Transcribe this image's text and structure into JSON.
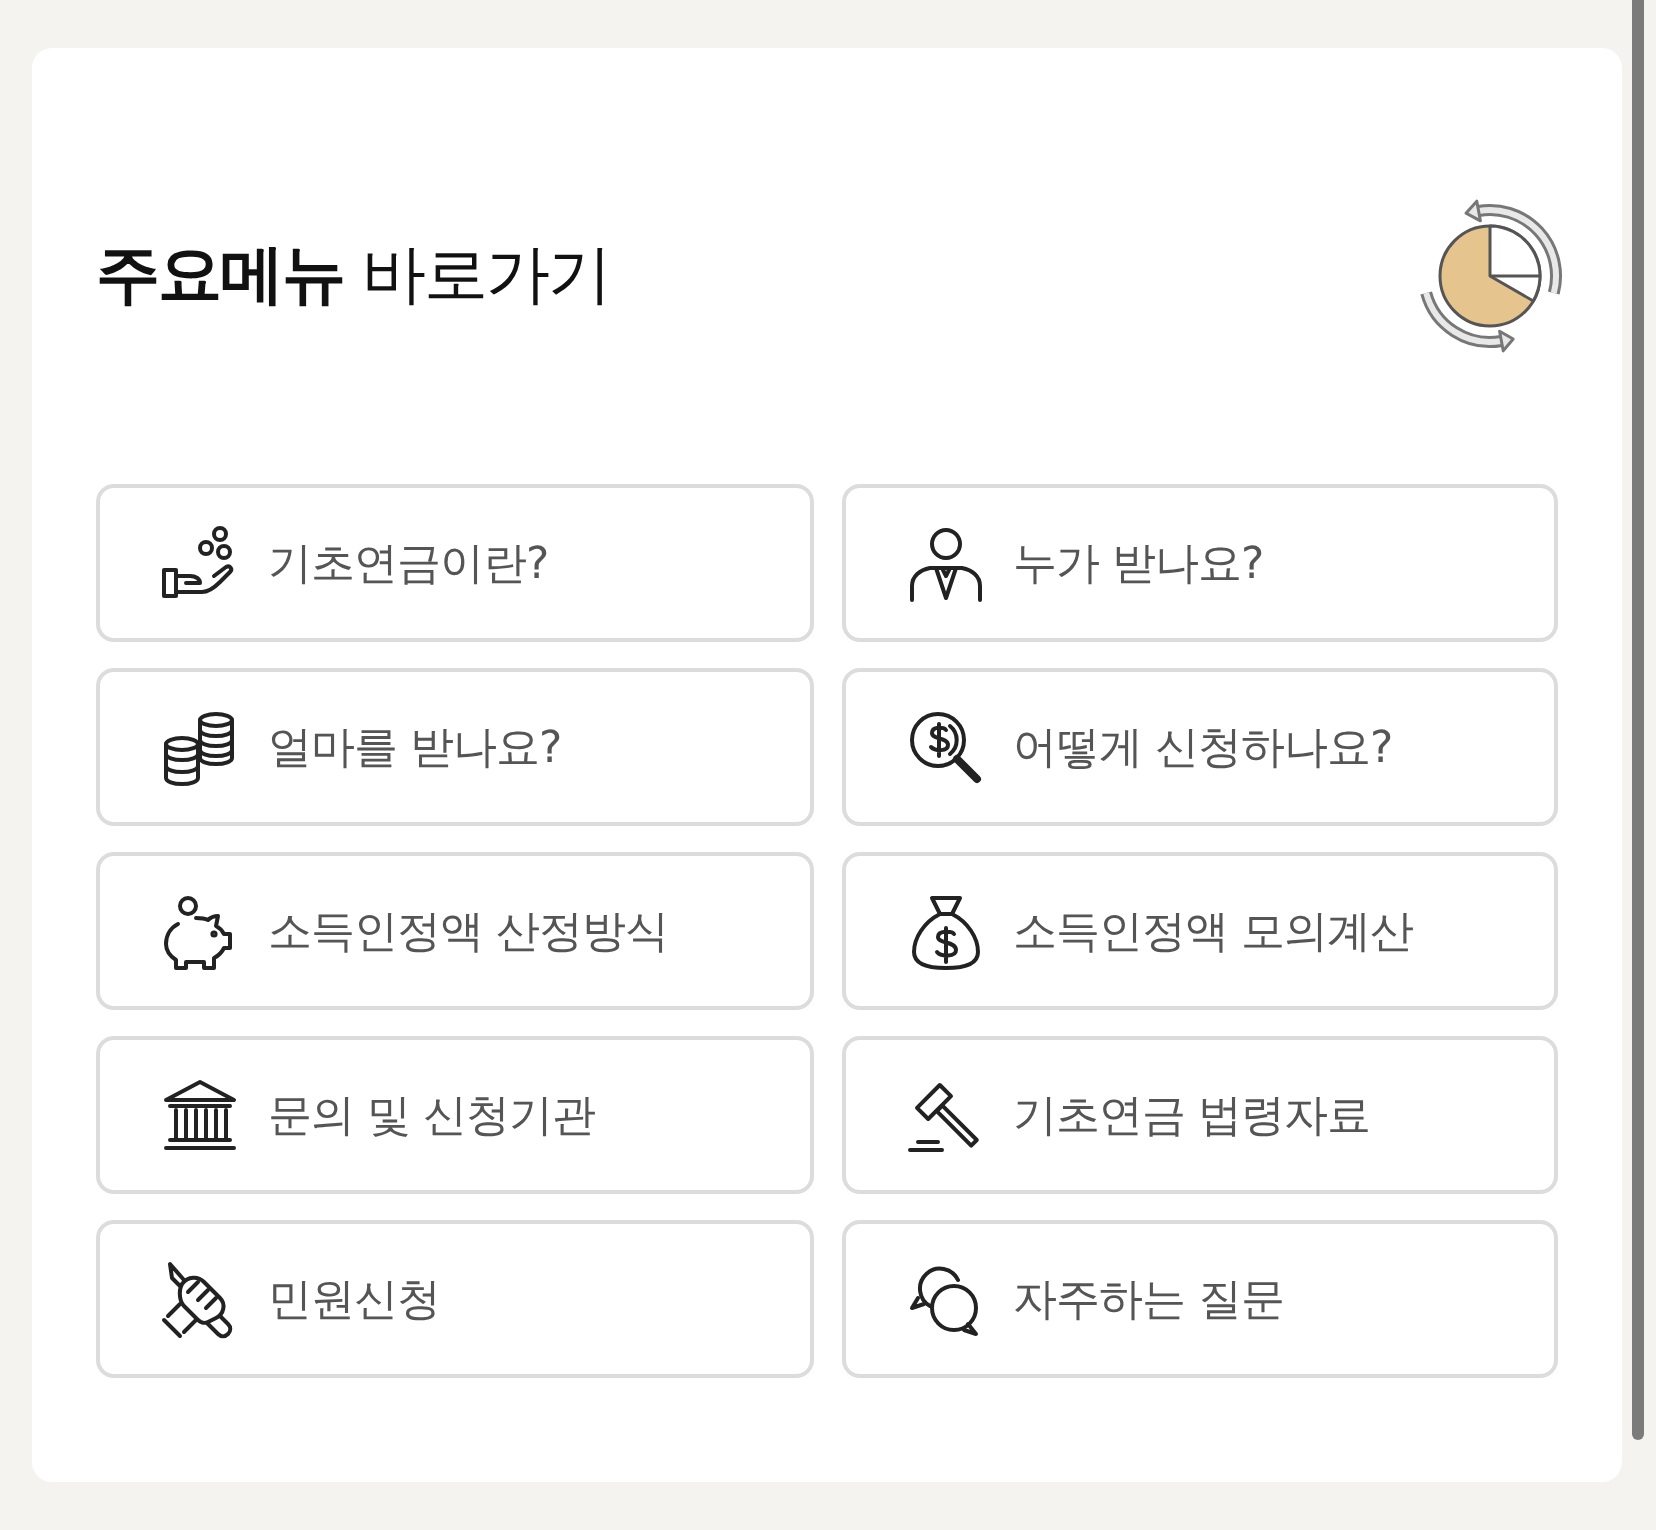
{
  "section": {
    "title": "**주요메뉴** 바로가기"
  },
  "menu_items": [
    {
      "label": "기초연금이란?"
    },
    {
      "label": "누가 받나요?"
    },
    {
      "label": "얼마를 받나요?"
    },
    {
      "label": "어떻게 신청하나요?"
    },
    {
      "label": "소득인정액 산정방식"
    },
    {
      "label": "소득인정액 모의계산"
    },
    {
      "label": "문의 및 신청기관"
    },
    {
      "label": "기초연금 법령자료"
    },
    {
      "label": "민원신청"
    },
    {
      "label": "자주하는 질문"
    }
  ]
}
